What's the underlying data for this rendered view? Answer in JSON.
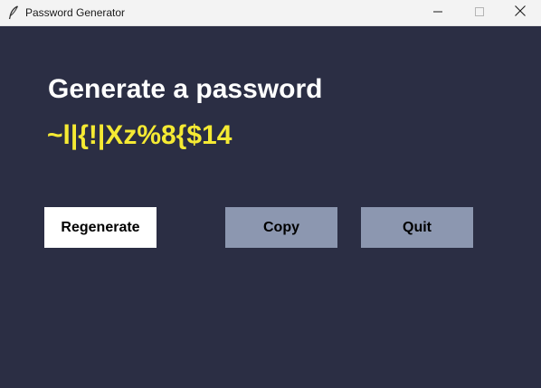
{
  "window": {
    "title": "Password Generator",
    "icon": "feather-icon",
    "controls": {
      "minimize_icon": "minimize-icon",
      "maximize_icon": "maximize-icon",
      "close_icon": "close-icon"
    }
  },
  "main": {
    "heading": "Generate a password",
    "password": "~l|{!|Xz%8{$14"
  },
  "buttons": {
    "regenerate": "Regenerate",
    "copy": "Copy",
    "quit": "Quit"
  },
  "colors": {
    "background": "#2b2e44",
    "password_text": "#f5ea33",
    "heading_text": "#ffffff",
    "button_primary": "#ffffff",
    "button_secondary": "#8c97b0"
  }
}
